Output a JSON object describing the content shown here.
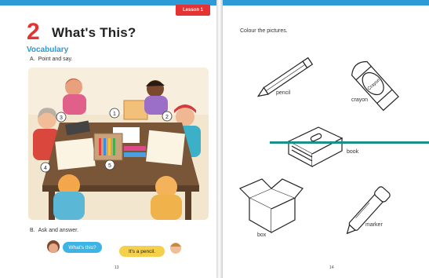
{
  "left_page": {
    "lesson_tab": "Lesson 1",
    "lesson_number": "2",
    "title": "What's This?",
    "section": "Vocabulary",
    "instruction_a_letter": "A.",
    "instruction_a_text": "Point and say.",
    "scene_numbers": [
      "1",
      "2",
      "3",
      "4",
      "5"
    ],
    "instruction_b_letter": "B.",
    "instruction_b_text": "Ask and answer.",
    "bubble_question": "What's this?",
    "bubble_answer": "It's a pencil.",
    "page_number": "13"
  },
  "right_page": {
    "instruction": "Colour the pictures.",
    "labels": {
      "pencil": "pencil",
      "crayon": "crayon",
      "book": "book",
      "box": "box",
      "marker": "marker"
    },
    "crayon_wrapper_text": "Crayon",
    "page_number": "14"
  },
  "colors": {
    "top_band": "#2e9bd6",
    "accent_red": "#e53232",
    "vocab_blue": "#2a9ad4",
    "teal_line": "#1d8f8a"
  }
}
